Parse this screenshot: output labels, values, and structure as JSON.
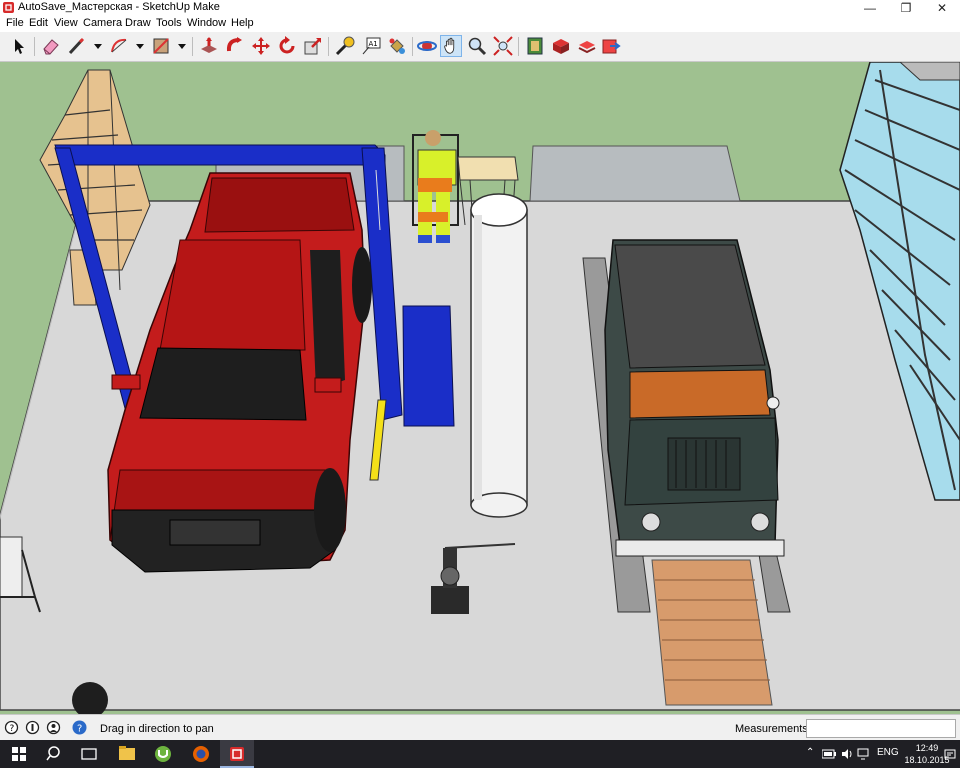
{
  "window": {
    "title": "AutoSave_Мастерская - SketchUp Make",
    "minimize_glyph": "—",
    "maximize_glyph": "❐",
    "close_glyph": "✕"
  },
  "menu": [
    "File",
    "Edit",
    "View",
    "Camera",
    "Draw",
    "Tools",
    "Window",
    "Help"
  ],
  "toolbar": {
    "tools": [
      "select",
      "eraser",
      "line",
      "arc",
      "shape",
      "push-pull",
      "follow-me",
      "move",
      "rotate",
      "scale",
      "tape-measure",
      "text",
      "paint-bucket",
      "orbit",
      "pan",
      "zoom",
      "zoom-extents",
      "3d-warehouse",
      "extension-warehouse",
      "layout",
      "send-to-layout"
    ],
    "active_tool": "pan"
  },
  "status": {
    "hint": "Drag in direction to pan",
    "measurements_label": "Measurements",
    "measurements_value": ""
  },
  "taskbar": {
    "language": "ENG",
    "time": "12:49",
    "date": "18.10.2015"
  },
  "colors": {
    "wall": "#9fc190",
    "floor": "#d6d6d6",
    "truck": "#c41c1c",
    "lift": "#1a2ec8",
    "jeep": "#3d4a47",
    "shelf": "#e6c28f",
    "glass": "#a7dcec"
  }
}
